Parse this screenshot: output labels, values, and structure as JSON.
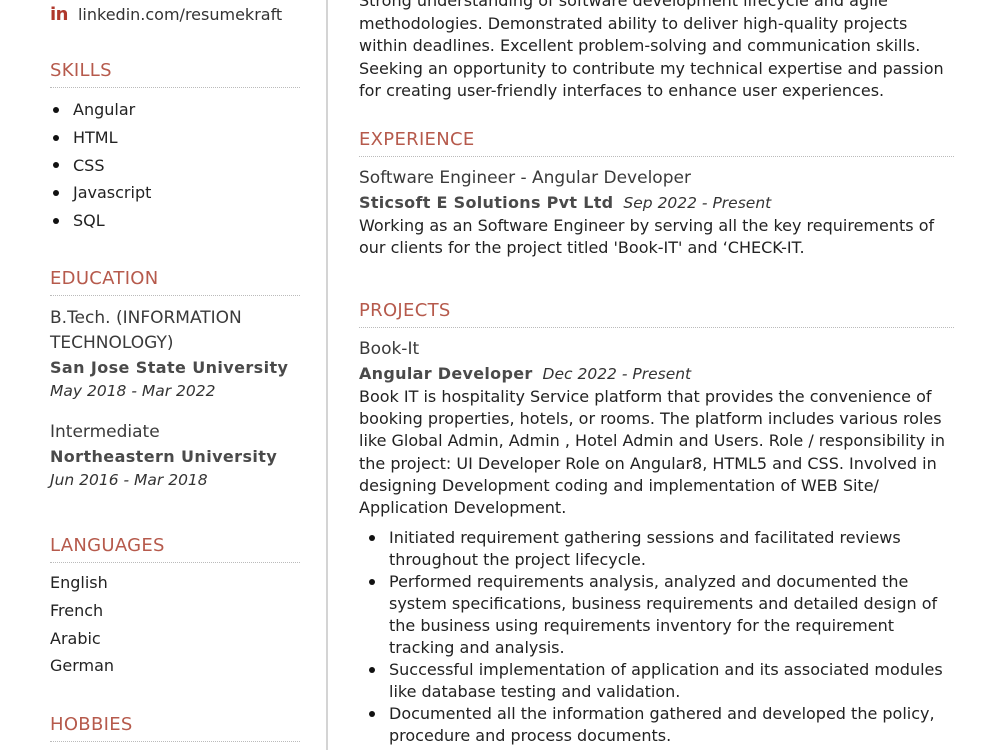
{
  "contact": {
    "linkedin_icon": "linkedin-icon",
    "linkedin": "linkedin.com/resumekraft"
  },
  "colors": {
    "accent": "#b65a4c",
    "icon": "#b0382c",
    "text": "#222222",
    "divider": "#d4d4d4"
  },
  "skills": {
    "title": "SKILLS",
    "items": [
      "Angular",
      "HTML",
      "CSS",
      "Javascript",
      "SQL"
    ]
  },
  "education": {
    "title": "EDUCATION",
    "entries": [
      {
        "degree": "B.Tech. (INFORMATION TECHNOLOGY)",
        "school": "San Jose State University",
        "dates": "May 2018 - Mar 2022"
      },
      {
        "degree": "Intermediate",
        "school": "Northeastern University",
        "dates": "Jun 2016 - Mar 2018"
      }
    ]
  },
  "languages": {
    "title": "LANGUAGES",
    "items": [
      "English",
      "French",
      "Arabic",
      "German"
    ]
  },
  "hobbies": {
    "title": "HOBBIES"
  },
  "summary": {
    "text": "Strong understanding of software development lifecycle and agile methodologies. Demonstrated ability to deliver high-quality projects within deadlines. Excellent problem-solving and communication skills. Seeking an opportunity to contribute my technical expertise and passion for creating user-friendly interfaces to enhance user experiences."
  },
  "experience": {
    "title": "EXPERIENCE",
    "jobs": [
      {
        "title": "Software Engineer - Angular Developer",
        "company": "Sticsoft E Solutions Pvt Ltd",
        "dates": "Sep 2022 - Present",
        "description": "Working as an Software Engineer by serving all the key requirements of our clients for the project titled 'Book-IT' and ‘CHECK-IT."
      }
    ]
  },
  "projects": {
    "title": "PROJECTS",
    "items": [
      {
        "name": "Book-It",
        "role": "Angular Developer",
        "dates": "Dec 2022 - Present",
        "description": "Book IT is hospitality Service platform that provides the convenience of booking properties, hotels, or rooms. The platform includes various roles like Global Admin, Admin , Hotel Admin and Users. Role / responsibility in the project: UI Developer Role on Angular8, HTML5 and CSS. Involved in designing Development coding and implementation of WEB Site/ Application Development.",
        "bullets": [
          "Initiated requirement gathering sessions and facilitated reviews throughout the project lifecycle.",
          "Performed requirements analysis, analyzed and documented the system specifications, business requirements and detailed design of the business using requirements inventory for the requirement tracking and analysis.",
          "Successful implementation of application and its associated modules like database testing and validation.",
          "Documented all the information gathered and developed the policy, procedure and process documents."
        ]
      }
    ]
  }
}
